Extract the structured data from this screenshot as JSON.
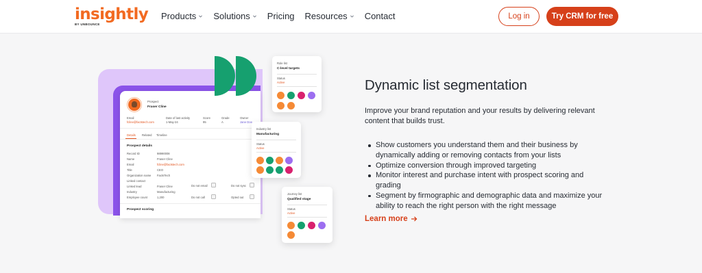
{
  "brand": {
    "name": "insightly",
    "sub": "BY UNBOUNCE",
    "accent": "#f26a21",
    "cta_color": "#d6401a"
  },
  "nav": {
    "items": [
      {
        "label": "Products",
        "dropdown": true
      },
      {
        "label": "Solutions",
        "dropdown": true
      },
      {
        "label": "Pricing",
        "dropdown": false
      },
      {
        "label": "Resources",
        "dropdown": true
      },
      {
        "label": "Contact",
        "dropdown": false
      }
    ],
    "login_label": "Log in",
    "cta_label": "Try CRM for free"
  },
  "crm_card": {
    "kind": "Prospect",
    "name": "Fraser Cline",
    "email_label": "Email",
    "email": "fcline@factstech.com",
    "activity_label": "Date of last activity",
    "activity": "1-May-24",
    "score_label": "Score",
    "score": "95",
    "grade_label": "Grade",
    "grade": "A",
    "owner_label": "Owner",
    "owner": "Jane Doe",
    "tabs": [
      "Details",
      "Related",
      "Timeline"
    ],
    "section_details": "Prospect details",
    "fields": [
      {
        "label": "Record ID",
        "value": "98990008"
      },
      {
        "label": "Name",
        "value": "Fraser Cline"
      },
      {
        "label": "Email",
        "value": "fcline@factstech.com"
      },
      {
        "label": "Title",
        "value": "CEO"
      },
      {
        "label": "Organization name",
        "value": "FactsTech"
      },
      {
        "label": "Linked contact",
        "value": ""
      },
      {
        "label": "Linked lead",
        "value": "Fraser Cline"
      },
      {
        "label": "Industry",
        "value": "Manufacturing"
      },
      {
        "label": "Employee count",
        "value": "1,200"
      }
    ],
    "toggles": [
      {
        "label": "Do not email"
      },
      {
        "label": "Do not sync"
      },
      {
        "label": "Do not call"
      },
      {
        "label": "Opted out"
      }
    ],
    "section_scoring": "Prospect scoring"
  },
  "role_card": {
    "title": "Role list",
    "name": "C-level targets",
    "status_label": "Status",
    "status": "Active"
  },
  "industry_card": {
    "title": "Industry list",
    "name": "Manufacturing",
    "status_label": "Status",
    "status": "Active"
  },
  "journey_card": {
    "title": "Journey list",
    "name": "Qualified stage",
    "status_label": "Status",
    "status": "Active"
  },
  "dot_colors": {
    "orange": "#f58a36",
    "green": "#16a06f",
    "pink": "#d9216e",
    "purple": "#9c6ef0"
  },
  "content": {
    "headline": "Dynamic list segmentation",
    "intro": "Improve your brand reputation and your results by delivering relevant content that builds trust.",
    "bullets": [
      "Show customers you understand them and their business by dynamically adding or removing contacts from your lists",
      "Optimize conversion through improved targeting",
      "Monitor interest and purchase intent with prospect scoring and grading",
      "Segment by firmographic and demographic data and maximize your ability to reach the right person with the right message"
    ],
    "learn_more": "Learn more"
  }
}
